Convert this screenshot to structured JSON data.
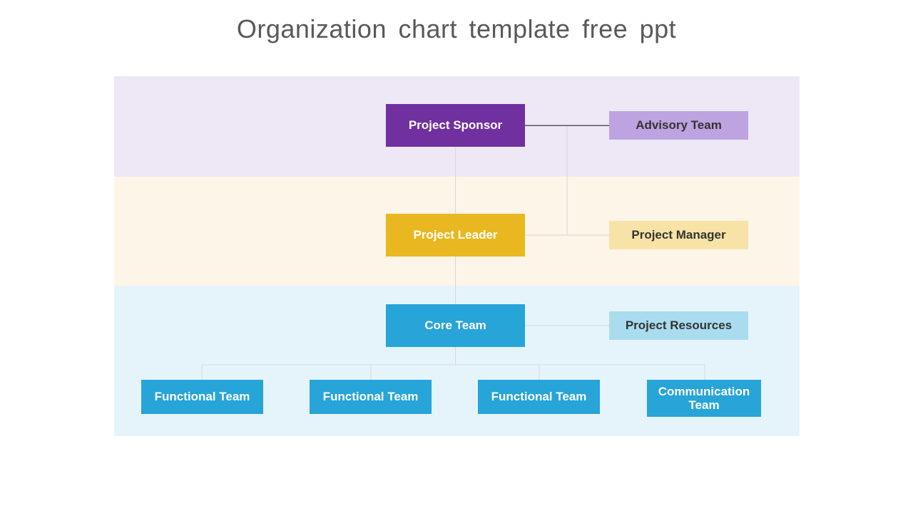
{
  "page": {
    "title": "Organization chart template free ppt",
    "title_color": "#595959",
    "background": "#ffffff"
  },
  "chart": {
    "bands": [
      {
        "name": "sponsor-band",
        "color": "#ede7f6"
      },
      {
        "name": "leader-band",
        "color": "#fdf5e8"
      },
      {
        "name": "team-band",
        "color": "#e5f4fb"
      }
    ],
    "connector_color": "#d8d8d8",
    "connector_color_strong": "#595959",
    "levels": [
      {
        "name": "sponsor",
        "primary": {
          "label": "Project Sponsor",
          "fill": "#7030a0",
          "text_color": "#ffffff"
        },
        "support": {
          "label": "Advisory Team",
          "fill": "#bda3e0",
          "text_color": "#333333"
        }
      },
      {
        "name": "leader",
        "primary": {
          "label": "Project Leader",
          "fill": "#e9b820",
          "text_color": "#ffffff"
        },
        "support": {
          "label": "Project Manager",
          "fill": "#f7e3a6",
          "text_color": "#333333"
        }
      },
      {
        "name": "core",
        "primary": {
          "label": "Core Team",
          "fill": "#27a4d8",
          "text_color": "#ffffff"
        },
        "support": {
          "label": "Project Resources",
          "fill": "#a9dcef",
          "text_color": "#333333"
        }
      }
    ],
    "teams": {
      "fill": "#27a4d8",
      "text_color": "#ffffff",
      "items": [
        {
          "label": "Functional Team"
        },
        {
          "label": "Functional Team"
        },
        {
          "label": "Functional Team"
        },
        {
          "label": "Communication Team"
        }
      ]
    }
  }
}
